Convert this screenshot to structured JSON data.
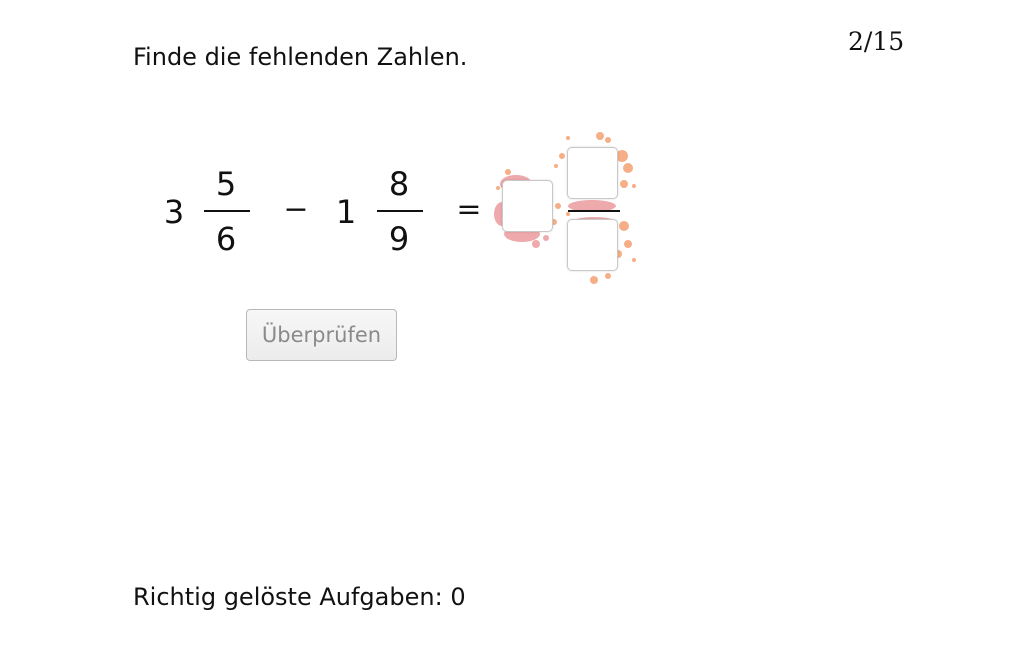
{
  "instruction": "Finde die fehlenden Zahlen.",
  "progress": "2/15",
  "equation": {
    "term1": {
      "whole": "3",
      "numerator": "5",
      "denominator": "6"
    },
    "operator": "−",
    "term2": {
      "whole": "1",
      "numerator": "8",
      "denominator": "9"
    },
    "equals": "=",
    "answer": {
      "whole": "",
      "numerator": "",
      "denominator": ""
    }
  },
  "check_button": {
    "label": "Überprüfen",
    "state": "disabled"
  },
  "score": {
    "label": "Richtig gelöste Aufgaben:",
    "value": "0"
  },
  "colors": {
    "splash_orange": "#f4a070",
    "splash_pink": "#e8858a",
    "button_text": "#8a8a8a"
  }
}
